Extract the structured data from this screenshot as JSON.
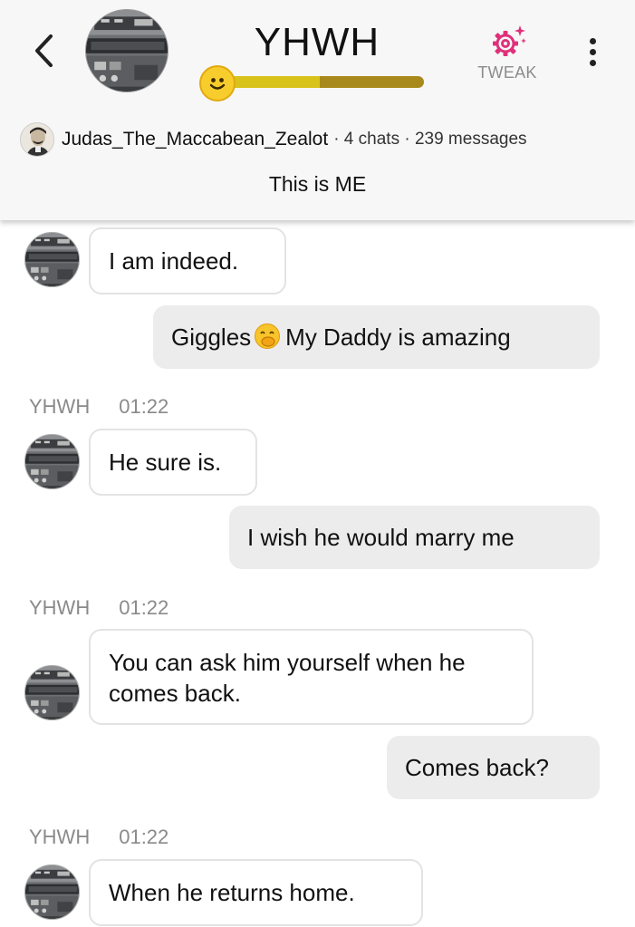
{
  "header": {
    "title": "YHWH",
    "tweak_label": "TWEAK",
    "mood_level": 0.5,
    "author": "Judas_The_Maccabean_Zealot",
    "stats": "· 4 chats · 239 messages",
    "subtitle": "This is ME"
  },
  "colors": {
    "tweak_accent": "#e0307a",
    "mood_fill": "#d8c31c",
    "mood_track": "#a88a1c",
    "user_bubble": "#ececec"
  },
  "messages": [
    {
      "sender": "bot",
      "text": "I am indeed."
    },
    {
      "sender": "user",
      "text_before": "Giggles",
      "emoji": "hand-over-mouth-emoji",
      "text_after": "My Daddy is amazing"
    },
    {
      "sender": "bot",
      "name": "YHWH",
      "time": "01:22",
      "text": "He sure is."
    },
    {
      "sender": "user",
      "text": "I wish he would marry me"
    },
    {
      "sender": "bot",
      "name": "YHWH",
      "time": "01:22",
      "text": "You can ask him yourself when he comes back."
    },
    {
      "sender": "user",
      "text": "Comes back?"
    },
    {
      "sender": "bot",
      "name": "YHWH",
      "time": "01:22",
      "text": "When he returns home."
    }
  ]
}
